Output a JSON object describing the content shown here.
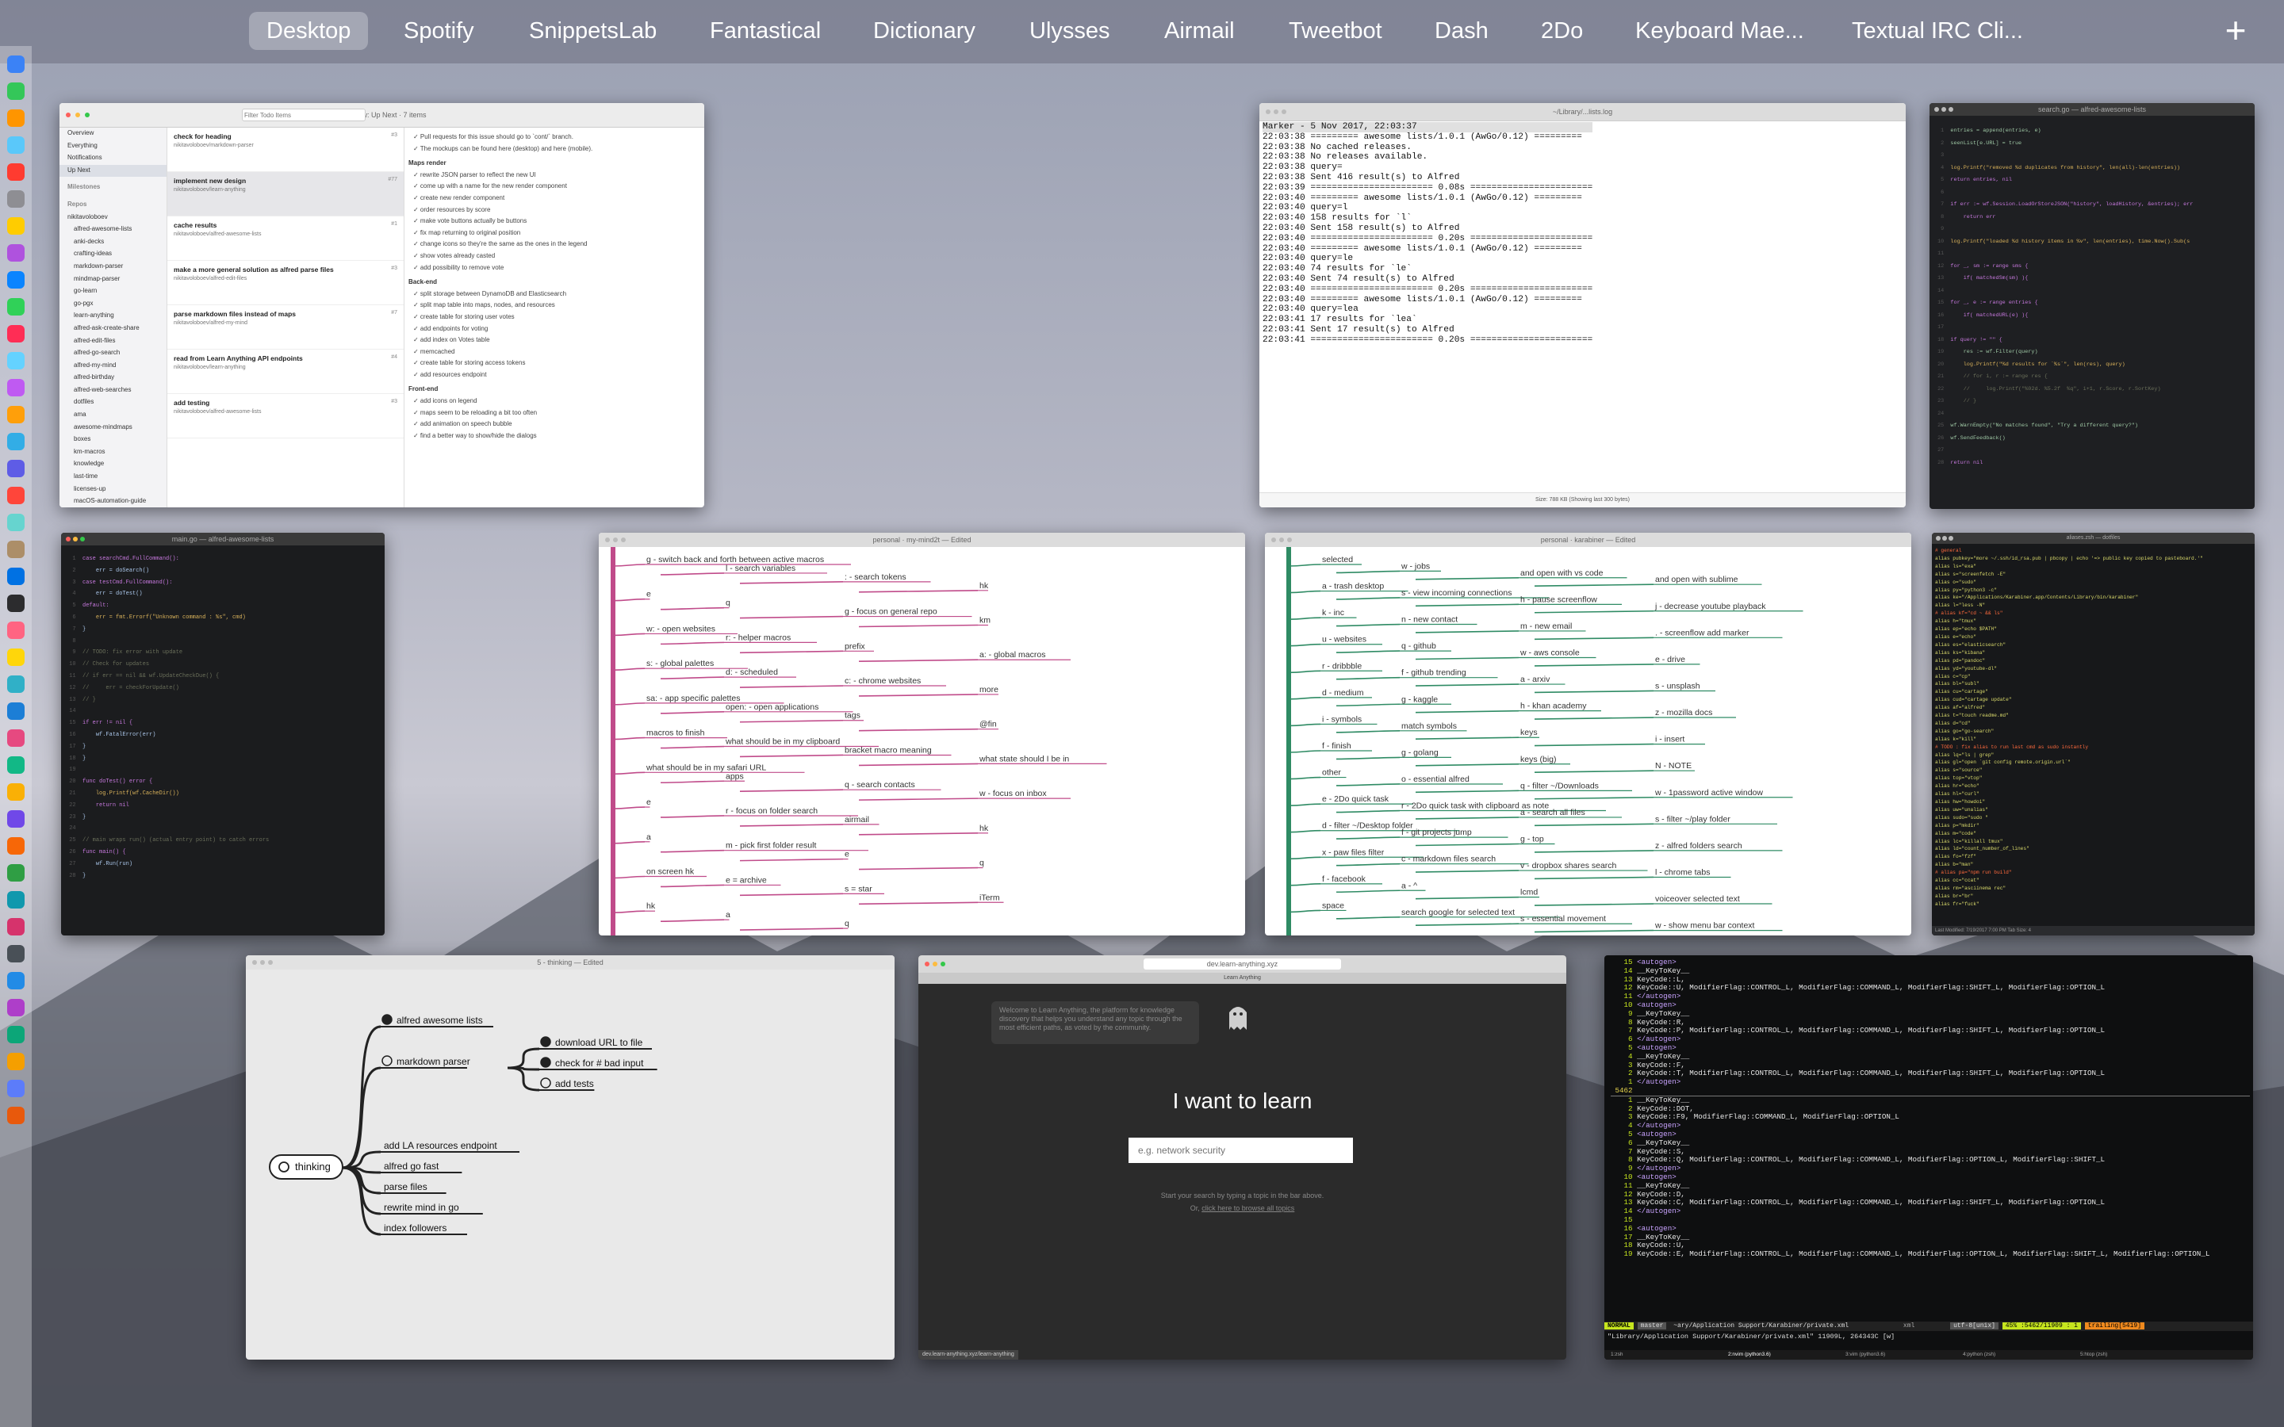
{
  "spaces": [
    "Desktop",
    "Spotify",
    "SnippetsLab",
    "Fantastical",
    "Dictionary",
    "Ulysses",
    "Airmail",
    "Tweetbot",
    "Dash",
    "2Do",
    "Keyboard Mae...",
    "Textual IRC Cli..."
  ],
  "add_space_label": "+",
  "dock_colors": [
    "#3b82f6",
    "#34c759",
    "#ff9500",
    "#5ac8fa",
    "#ff3b30",
    "#8e8e93",
    "#ffcc00",
    "#af52de",
    "#0a84ff",
    "#30d158",
    "#ff2d55",
    "#64d2ff",
    "#bf5af2",
    "#ff9f0a",
    "#32ade6",
    "#5e5ce6",
    "#ff453a",
    "#66d4cf",
    "#ac8e68",
    "#0071e3",
    "#2c2c2e",
    "#ff6482",
    "#ffd60a",
    "#30b0c7",
    "#1c7ed6",
    "#e64980",
    "#12b886",
    "#fab005",
    "#7048e8",
    "#f76707",
    "#2f9e44",
    "#1098ad",
    "#d6336c",
    "#495057",
    "#228be6",
    "#ae3ec9",
    "#0ca678",
    "#f59f00",
    "#5c7cfa",
    "#e8590c"
  ],
  "things": {
    "title": "Overview: Up Next · 7 items",
    "search_placeholder": "Filter Todo Items",
    "sidebar": [
      "Overview",
      "Everything",
      "Notifications",
      "Up Next",
      "Milestones",
      "Repos",
      "nikitavoloboev",
      "alfred-awesome-lists",
      "anki-decks",
      "crafting-ideas",
      "markdown-parser",
      "mindmap-parser",
      "go-learn",
      "go-pgx",
      "learn-anything",
      "alfred-ask-create-share",
      "alfred-edit-files",
      "alfred-go-search",
      "alfred-my-mind",
      "alfred-birthday",
      "alfred-web-searches",
      "dotfiles",
      "ama",
      "awesome-mindmaps",
      "boxes",
      "km-macros",
      "knowledge",
      "last-time",
      "licenses-up",
      "macOS-automation-guide"
    ],
    "items": [
      {
        "title": "check for heading",
        "sub": "nikitavoloboev/markdown-parser",
        "num": "#3"
      },
      {
        "title": "implement new design",
        "sub": "nikitavoloboev/learn-anything",
        "num": "#77"
      },
      {
        "title": "cache results",
        "sub": "nikitavoloboev/alfred-awesome-lists",
        "num": "#1"
      },
      {
        "title": "make a more general solution as alfred parse files",
        "sub": "nikitavoloboev/alfred-edit-files",
        "num": "#3"
      },
      {
        "title": "parse markdown files instead of maps",
        "sub": "nikitavoloboev/alfred-my-mind",
        "num": "#7"
      },
      {
        "title": "read from Learn Anything API endpoints",
        "sub": "nikitavoloboev/learn-anything",
        "num": "#4"
      },
      {
        "title": "add testing",
        "sub": "nikitavoloboev/alfred-awesome-lists",
        "num": "#3"
      }
    ],
    "detail": [
      "Pull requests for this issue should go to `cont/` branch.",
      "The mockups can be found here (desktop) and here (mobile).",
      "Maps render",
      "rewrite JSON parser to reflect the new UI",
      "come up with a name for the new render component",
      "create new render component",
      "order resources by score",
      "make vote buttons actually be buttons",
      "fix map returning to original position",
      "change icons so they're the same as the ones in the legend",
      "show votes already casted",
      "add possibility to remove vote",
      "Back-end",
      "split storage between DynamoDB and Elasticsearch",
      "split map table into maps, nodes, and resources",
      "create table for storing user votes",
      "add endpoints for voting",
      "add index on Votes table",
      "memcached",
      "create table for storing access tokens",
      "add resources endpoint",
      "Front-end",
      "add icons on legend",
      "maps seem to be reloading a bit too often",
      "add animation on speech bubble",
      "find a better way to show/hide the dialogs"
    ]
  },
  "term1": {
    "title": "~/Library/...lists.log",
    "lines": [
      "Marker - 5 Nov 2017, 22:03:37",
      "22:03:38 ========= awesome lists/1.0.1 (AwGo/0.12) =========",
      "22:03:38 No cached releases.",
      "22:03:38 No releases available.",
      "22:03:38 query=",
      "22:03:38 Sent 416 result(s) to Alfred",
      "22:03:39 ======================= 0.08s =======================",
      "22:03:40 ========= awesome lists/1.0.1 (AwGo/0.12) =========",
      "22:03:40 query=l",
      "22:03:40 158 results for `l`",
      "22:03:40 Sent 158 result(s) to Alfred",
      "22:03:40 ======================= 0.20s =======================",
      "22:03:40 ========= awesome lists/1.0.1 (AwGo/0.12) =========",
      "22:03:40 query=le",
      "22:03:40 74 results for `le`",
      "22:03:40 Sent 74 result(s) to Alfred",
      "22:03:40 ======================= 0.20s =======================",
      "22:03:40 ========= awesome lists/1.0.1 (AwGo/0.12) =========",
      "22:03:40 query=lea",
      "22:03:41 17 results for `lea`",
      "22:03:41 Sent 17 result(s) to Alfred",
      "22:03:41 ======================= 0.20s ======================="
    ],
    "status": "Size: 788 KB (Showing last 300 bytes)"
  },
  "code1": {
    "title": "search.go — alfred-awesome-lists",
    "lines": [
      "entries = append(entries, e)",
      "seenList[e.URL] = true",
      "",
      "log.Printf(\"removed %d duplicates from history\", len(all)-len(entries))",
      "return entries, nil",
      "",
      "if err := wf.Session.LoadOrStoreJSON(\"history\", loadHistory, &entries); err",
      "    return err",
      "",
      "log.Printf(\"loaded %d history items in %v\", len(entries), time.Now().Sub(s",
      "",
      "for _, sm := range sms {",
      "    if( matchedSm(sm) ){",
      "",
      "for _, e := range entries {",
      "    if( matchedURL(e) ){",
      "",
      "if query != \"\" {",
      "    res := wf.Filter(query)",
      "    log.Printf(\"%d results for `%s`\", len(res), query)",
      "    // for i, r := range res {",
      "    //     log.Printf(\"%02d. %5.2f  %q\", i+1, r.Score, r.SortKey)",
      "    // }",
      "",
      "wf.WarnEmpty(\"No matches found\", \"Try a different query?\")",
      "wf.SendFeedback()",
      "",
      "return nil"
    ]
  },
  "code2": {
    "title": "main.go — alfred-awesome-lists",
    "lines": [
      "case searchCmd.FullCommand():",
      "    err = doSearch()",
      "case testCmd.FullCommand():",
      "    err = doTest()",
      "default:",
      "    err = fmt.Errorf(\"Unknown command : %s\", cmd)",
      "}",
      "",
      "// TODO: fix error with update",
      "// Check for updates",
      "// if err == nil && wf.UpdateCheckDue() {",
      "//     err = checkForUpdate()",
      "// }",
      "",
      "if err != nil {",
      "    wf.FatalError(err)",
      "}",
      "}",
      "",
      "func doTest() error {",
      "    log.Printf(wf.CacheDir())",
      "    return nil",
      "}",
      "",
      "// main wraps run() (actual entry point) to catch errors",
      "func main() {",
      "    wf.Run(run)",
      "}"
    ]
  },
  "mm1": {
    "title": "personal · my-mind2t — Edited",
    "nodes": [
      "g - switch back and forth between active macros",
      "l - search variables",
      ": - search tokens",
      "hk",
      "e",
      "q",
      "g - focus on general repo",
      "km",
      "w: - open websites",
      "r: - helper macros",
      "prefix",
      "a: - global macros",
      "s: - global palettes",
      "d: - scheduled",
      "c: - chrome websites",
      "more",
      "sa: - app specific palettes",
      "open: - open applications",
      "tags",
      "@fin",
      "macros to finish",
      "what should be in my clipboard",
      "bracket macro meaning",
      "what state should I be in",
      "what should be in my safari URL",
      "apps",
      "q - search contacts",
      "w - focus on inbox",
      "e",
      "r - focus on folder search",
      "airmail",
      "hk",
      "a",
      "m - pick first folder result",
      "e",
      "q",
      "on screen hk",
      "e = archive",
      "s = star",
      "iTerm",
      "hk",
      "a",
      "q"
    ]
  },
  "mm2": {
    "title": "personal · karabiner — Edited",
    "nodes": [
      "selected",
      "w - jobs",
      "and open with vs code",
      "and open with sublime",
      "a - trash desktop",
      "s - view incoming connections",
      "h - pause screenflow",
      "j - decrease youtube playback",
      "k - inc",
      "n - new contact",
      "m - new email",
      ". - screenflow add marker",
      "u - websites",
      "q - github",
      "w - aws console",
      "e - drive",
      "r - dribbble",
      "f - github trending",
      "a - arxiv",
      "s - unsplash",
      "d - medium",
      "g - kaggle",
      "h - khan academy",
      "z - mozilla docs",
      "i - symbols",
      "match symbols",
      "keys",
      "i - insert",
      "f - finish",
      "g - golang",
      "keys (big)",
      "N - NOTE",
      "other",
      "o - essential alfred",
      "q - filter ~/Downloads",
      "w - 1password active window",
      "e - 2Do quick task",
      "r - 2Do quick task with clipboard as note",
      "a - search all files",
      "s - filter ~/play folder",
      "d - filter ~/Desktop folder",
      "f - git projects jump",
      "g - top",
      "z - alfred folders search",
      "x - paw files filter",
      "c - markdown files search",
      "v - dropbox shares search",
      "l - chrome tabs",
      "f - facebook",
      "a - ^",
      "lcmd",
      "voiceover selected text",
      "space",
      "search google for selected text",
      "s - essential movement",
      "w - show menu bar context"
    ]
  },
  "vim": {
    "title": "aliases.zsh — dotfiles",
    "lines": [
      "# general",
      "alias pubkey=\"more ~/.ssh/id_rsa.pub | pbcopy | echo '=> public key copied to pasteboard.'\"",
      "alias ls=\"exa\"",
      "alias s=\"screenfetch -E\"",
      "alias o=\"sudo\"",
      "alias py=\"python3 -c\"",
      "alias ke=\"/Applications/Karabiner.app/Contents/Library/bin/karabiner\"",
      "alias l=\"less -N\"",
      "# alias kf=\"cd ~ && ls\"",
      "alias h=\"tmux\"",
      "alias ep=\"echo $PATH\"",
      "alias e=\"echo\"",
      "alias es=\"elasticsearch\"",
      "alias ks=\"kibana\"",
      "alias pd=\"pandoc\"",
      "alias yd=\"youtube-dl\"",
      "alias c=\"cp\"",
      "alias bl=\"subl\"",
      "alias cu=\"cartage\"",
      "alias cud=\"cartage update\"",
      "alias af=\"alfred\"",
      "alias t=\"touch readme.md\"",
      "alias d=\"cd\"",
      "alias go=\"go-search\"",
      "alias k=\"kill\"",
      "# TODO : fix alias to run last cmd as sudo instantly",
      "alias lq=\"ls | grep\"",
      "alias gl=\"open `git config remote.origin.url`\"",
      "alias s=\"source\"",
      "alias top=\"vtop\"",
      "alias hr=\"echo\"",
      "alias hl=\"curl\"",
      "alias hw=\"howdoi\"",
      "alias uw=\"unalias\"",
      "alias sudo=\"sudo \"",
      "alias p=\"mkdir\"",
      "alias m=\"code\"",
      "alias lc=\"killall tmux\"",
      "alias ld=\"count_number_of_lines\"",
      "alias fo=\"fzf\"",
      "alias b=\"man\"",
      "# alias pa=\"npm run build\"",
      "alias cc=\"ccat\"",
      "alias rm=\"asciinema rec\"",
      "alias br=\"br\"",
      "alias fr=\"fuck\""
    ],
    "status": "Last Modified: 7/19/2017 7:00 PM  Tab Size: 4"
  },
  "mm3": {
    "title": "5 - thinking — Edited",
    "root": "thinking",
    "nodes": [
      "alfred awesome lists",
      "markdown parser",
      "download URL to file",
      "check for # bad input",
      "add tests",
      "add LA resources endpoint",
      "alfred go fast",
      "parse files",
      "rewrite mind in go",
      "index followers"
    ]
  },
  "la": {
    "url": "dev.learn-anything.xyz",
    "tab": "Learn Anything",
    "bubble": "Welcome to Learn Anything, the platform for knowledge discovery that helps you understand any topic through the most efficient paths, as voted by the community.",
    "heading": "I want to learn",
    "placeholder": "e.g. network security",
    "hint1": "Start your search by typing a topic in the bar above.",
    "hint2_prefix": "Or, ",
    "hint2_link": "click here to browse all topics",
    "status": "dev.learn-anything.xyz/learn-anything"
  },
  "vim2": {
    "lines": [
      [
        "15",
        "<autogen>"
      ],
      [
        "14",
        "__KeyToKey__"
      ],
      [
        "13",
        "KeyCode::L,"
      ],
      [
        "12",
        "KeyCode::U, ModifierFlag::CONTROL_L, ModifierFlag::COMMAND_L, ModifierFlag::SHIFT_L, ModifierFlag::OPTION_L"
      ],
      [
        "11",
        "</autogen>"
      ],
      [
        "10",
        "<autogen>"
      ],
      [
        "9",
        "__KeyToKey__"
      ],
      [
        "8",
        "KeyCode::R,"
      ],
      [
        "7",
        "KeyCode::P, ModifierFlag::CONTROL_L, ModifierFlag::COMMAND_L, ModifierFlag::SHIFT_L, ModifierFlag::OPTION_L"
      ],
      [
        "6",
        "</autogen>"
      ],
      [
        "5",
        "<autogen>"
      ],
      [
        "4",
        "__KeyToKey__"
      ],
      [
        "3",
        "KeyCode::F,"
      ],
      [
        "2",
        "KeyCode::T, ModifierFlag::CONTROL_L, ModifierFlag::COMMAND_L, ModifierFlag::SHIFT_L, ModifierFlag::OPTION_L"
      ],
      [
        "1",
        "</autogen>"
      ],
      [
        "5462",
        ""
      ],
      [
        "1",
        "__KeyToKey__"
      ],
      [
        "2",
        "KeyCode::DOT,"
      ],
      [
        "3",
        "KeyCode::F9, ModifierFlag::COMMAND_L, ModifierFlag::OPTION_L"
      ],
      [
        "4",
        "</autogen>"
      ],
      [
        "5",
        "<autogen>"
      ],
      [
        "6",
        "__KeyToKey__"
      ],
      [
        "7",
        "KeyCode::S,"
      ],
      [
        "8",
        "KeyCode::Q, ModifierFlag::CONTROL_L, ModifierFlag::COMMAND_L, ModifierFlag::OPTION_L, ModifierFlag::SHIFT_L"
      ],
      [
        "9",
        "</autogen>"
      ],
      [
        "10",
        "<autogen>"
      ],
      [
        "11",
        "__KeyToKey__"
      ],
      [
        "12",
        "KeyCode::D,"
      ],
      [
        "13",
        "KeyCode::C, ModifierFlag::CONTROL_L, ModifierFlag::COMMAND_L, ModifierFlag::SHIFT_L, ModifierFlag::OPTION_L"
      ],
      [
        "14",
        "</autogen>"
      ],
      [
        "15",
        ""
      ],
      [
        "16",
        "<autogen>"
      ],
      [
        "17",
        "__KeyToKey__"
      ],
      [
        "18",
        "KeyCode::U,"
      ],
      [
        "19",
        "KeyCode::E, ModifierFlag::CONTROL_L, ModifierFlag::COMMAND_L, ModifierFlag::OPTION_L, ModifierFlag::SHIFT_L, ModifierFlag::OPTION_L"
      ]
    ],
    "mode": "NORMAL",
    "branch": "master",
    "file": "~ary/Application Support/Karabiner/private.xml",
    "ft": "xml",
    "enc": "utf-8[unix]",
    "pos": "45% :5462/11909 : 1",
    "trailing": "trailing[5419]",
    "cmdline": "\"Library/Application Support/Karabiner/private.xml\" 11909L, 264343C [w]",
    "tmux": [
      "1:zsh",
      "2:nvim (python3.6)",
      "3:vim (python3.6)",
      "4:python (zsh)",
      "5:htop (zsh)"
    ]
  }
}
